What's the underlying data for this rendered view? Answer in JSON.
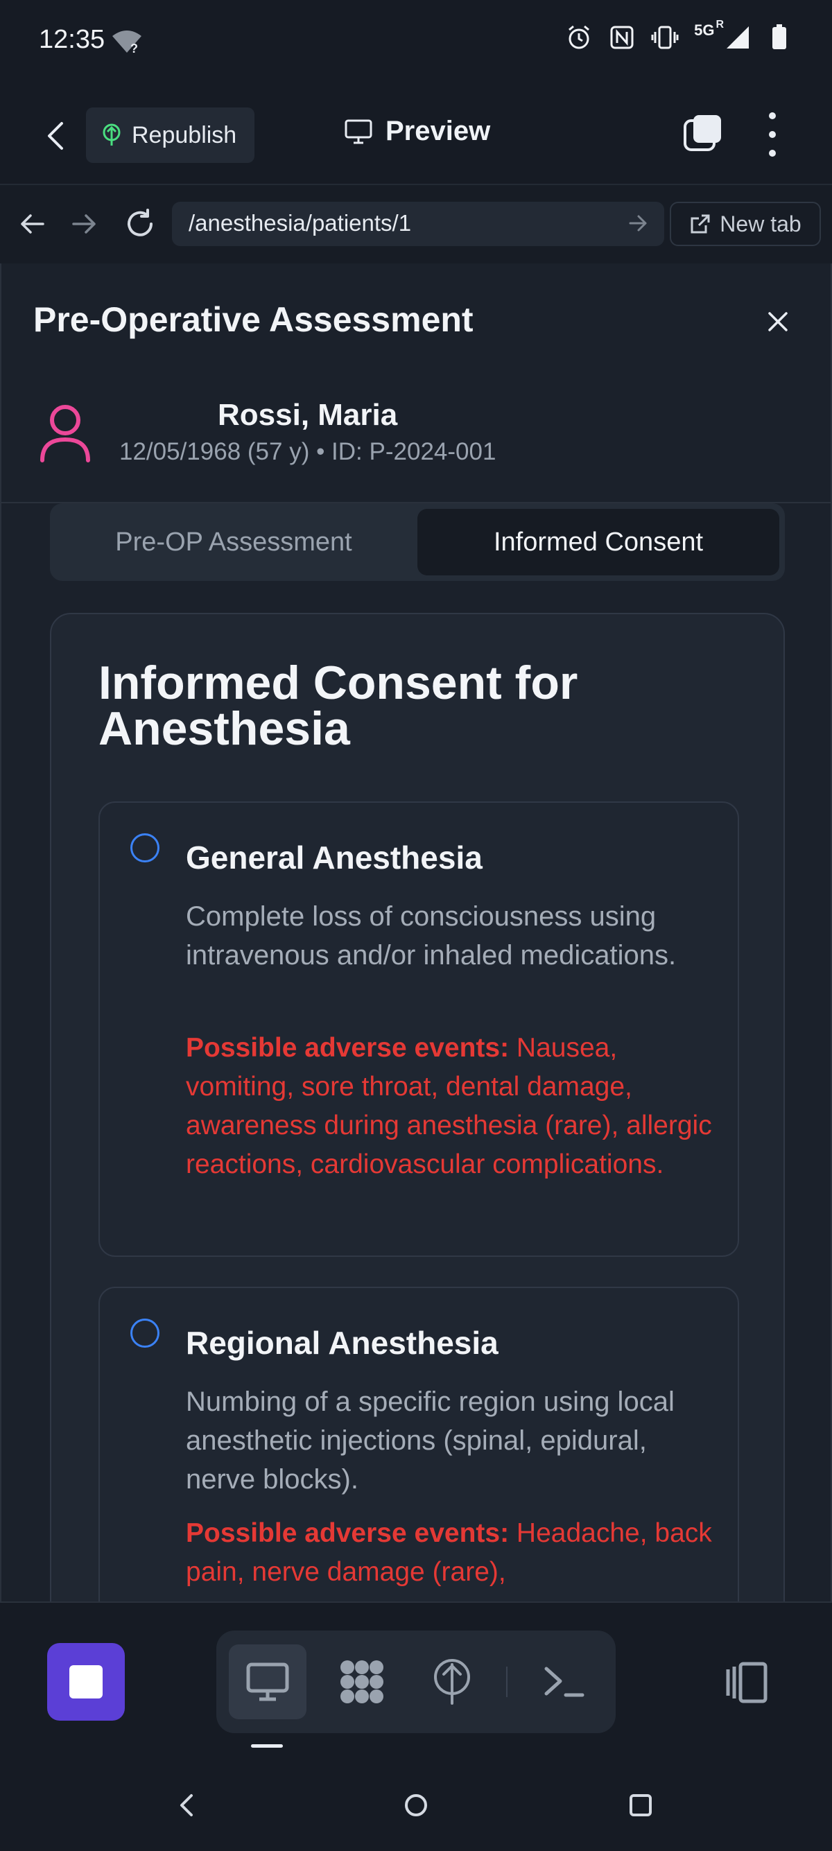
{
  "status_bar": {
    "time": "12:35",
    "network": "5G",
    "network_sup": "R",
    "icons": [
      "wifi-unknown-icon",
      "alarm-icon",
      "nfc-icon",
      "vibrate-icon",
      "signal-icon",
      "battery-icon"
    ]
  },
  "app_bar": {
    "republish_label": "Republish",
    "preview_label": "Preview"
  },
  "browser": {
    "url": "/anesthesia/patients/1",
    "new_tab_label": "New tab"
  },
  "page": {
    "title": "Pre-Operative Assessment",
    "patient": {
      "name": "Rossi, Maria",
      "meta": "12/05/1968 (57 y) • ID: P-2024-001"
    },
    "tabs": [
      {
        "label": "Pre-OP Assessment",
        "active": false
      },
      {
        "label": "Informed Consent",
        "active": true
      }
    ],
    "consent": {
      "title": "Informed Consent for Anesthesia",
      "options": [
        {
          "title": "General Anesthesia",
          "description": "Complete loss of consciousness using intravenous and/or inhaled medications.",
          "risk_label": "Possible adverse events:",
          "risk_text": "Nausea, vomiting, sore throat, dental damage, awareness during anesthesia (rare), allergic reactions, cardiovascular complications.",
          "selected": false
        },
        {
          "title": "Regional Anesthesia",
          "description": "Numbing of a specific region using local anesthetic injections (spinal, epidural, nerve blocks).",
          "risk_label": "Possible adverse events:",
          "risk_text": "Headache, back pain, nerve damage (rare),",
          "selected": false
        }
      ]
    }
  },
  "colors": {
    "background": "#161b24",
    "card": "#202732",
    "accent_radio": "#3b82f6",
    "risk_red": "#e53935",
    "stop_button": "#5b3fd6",
    "avatar_pink": "#ec4899",
    "republish_icon_green": "#4ade80"
  }
}
